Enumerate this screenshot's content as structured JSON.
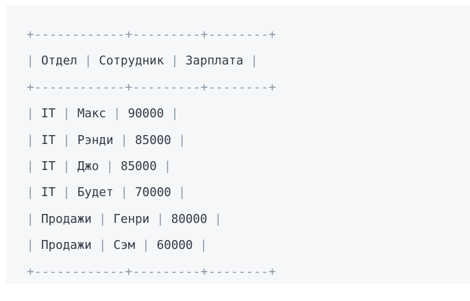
{
  "table": {
    "border_line": "+------------+---------+--------+",
    "header": [
      "Отдел",
      "Сотрудник",
      "Зарплата"
    ],
    "rows": [
      [
        "IT",
        "Макс",
        "90000"
      ],
      [
        "IT",
        "Рэнди",
        "85000"
      ],
      [
        "IT",
        "Джо",
        "85000"
      ],
      [
        "IT",
        "Будет",
        "70000"
      ],
      [
        "Продажи",
        "Генри",
        "80000"
      ],
      [
        "Продажи",
        "Сэм",
        "60000"
      ]
    ]
  },
  "colors": {
    "background": "#f6f7f8",
    "text": "#2f3a46",
    "border": "#8896a8"
  }
}
